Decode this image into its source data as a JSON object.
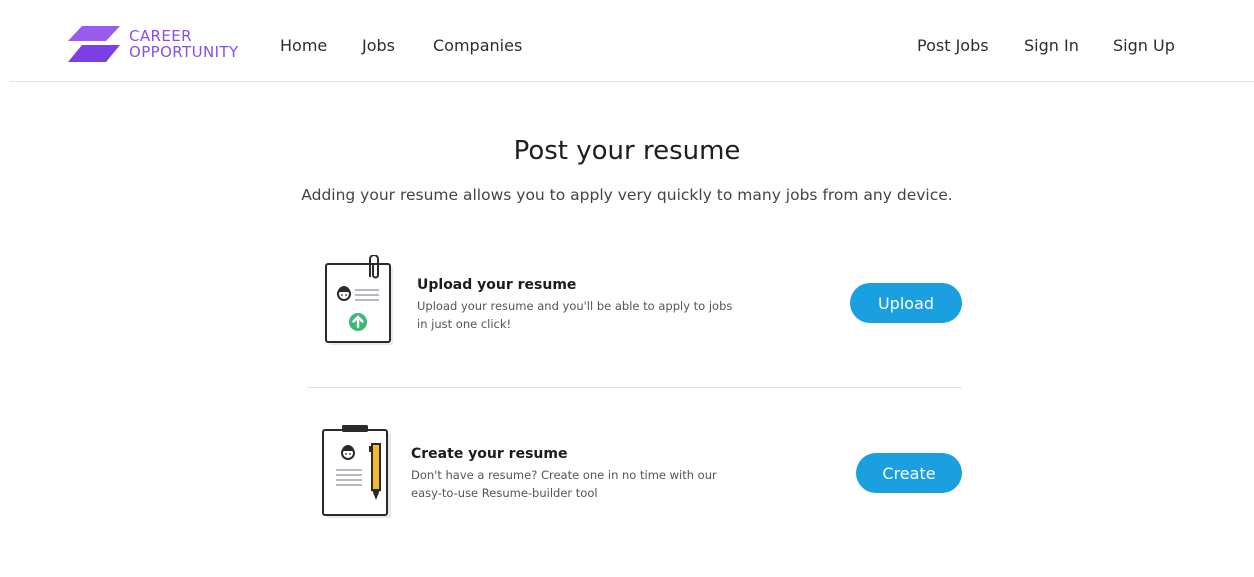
{
  "brand": {
    "line1": "CAREER",
    "line2": "OPPORTUNITY",
    "color": "#8a4de6"
  },
  "nav": {
    "left": [
      "Home",
      "Jobs",
      "Companies"
    ],
    "right": [
      "Post Jobs",
      "Sign In",
      "Sign Up"
    ]
  },
  "main": {
    "title": "Post your resume",
    "subtitle": "Adding your resume allows you to apply very quickly to many jobs from any device."
  },
  "upload": {
    "title": "Upload your resume",
    "desc_line1": "Upload your resume and you'll be able to apply to jobs",
    "desc_line2": "in just one click!",
    "button": "Upload",
    "icon": "resume-upload-icon"
  },
  "create": {
    "title": "Create your resume",
    "desc_line1": "Don't have a resume? Create one in no time with our",
    "desc_line2": "easy-to-use Resume-builder tool",
    "button": "Create",
    "icon": "resume-builder-icon"
  },
  "colors": {
    "accent": "#1a9fe0",
    "brand": "#8a4de6",
    "upload_green": "#3cb878",
    "pencil_yellow": "#f5b82e"
  }
}
